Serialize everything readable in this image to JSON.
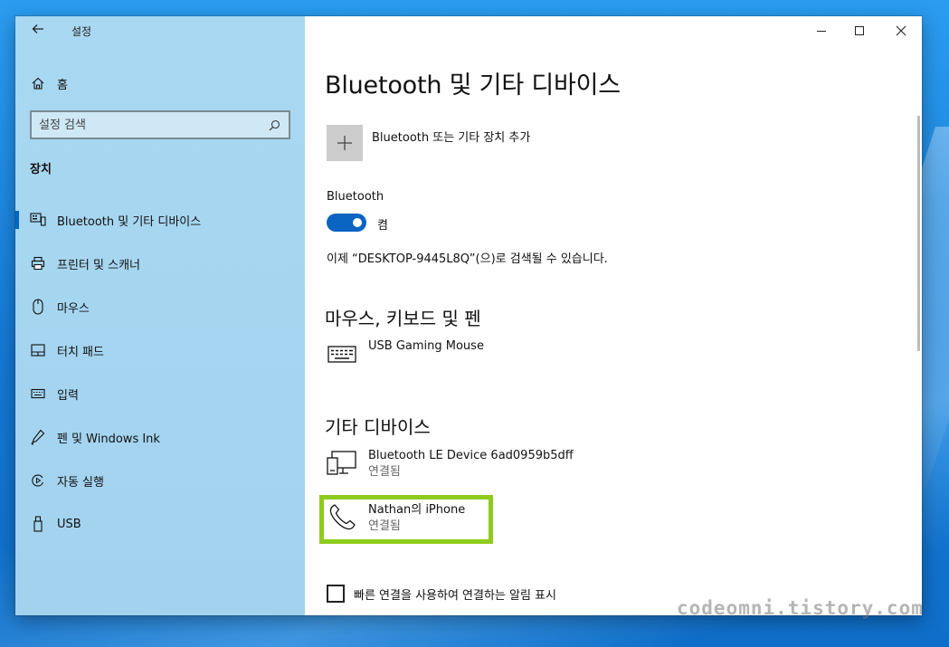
{
  "window": {
    "title": "설정",
    "back_icon": "back-arrow-icon",
    "minimize_icon": "minimize-icon",
    "maximize_icon": "maximize-icon",
    "close_icon": "close-icon"
  },
  "sidebar": {
    "home_label": "홈",
    "search_placeholder": "설정 검색",
    "section_title": "장치",
    "items": [
      {
        "label": "Bluetooth 및 기타 디바이스",
        "icon": "bluetooth-devices-icon",
        "active": true
      },
      {
        "label": "프린터 및 스캐너",
        "icon": "printer-icon",
        "active": false
      },
      {
        "label": "마우스",
        "icon": "mouse-icon",
        "active": false
      },
      {
        "label": "터치 패드",
        "icon": "touchpad-icon",
        "active": false
      },
      {
        "label": "입력",
        "icon": "keyboard-icon",
        "active": false
      },
      {
        "label": "펜 및 Windows Ink",
        "icon": "pen-icon",
        "active": false
      },
      {
        "label": "자동 실행",
        "icon": "autoplay-icon",
        "active": false
      },
      {
        "label": "USB",
        "icon": "usb-icon",
        "active": false
      }
    ]
  },
  "main": {
    "page_title": "Bluetooth 및 기타 디바이스",
    "add_device_label": "Bluetooth 또는 기타 장치 추가",
    "bluetooth_label": "Bluetooth",
    "toggle_state": "켬",
    "discover_text": "이제 “DESKTOP-9445L8Q”(으)로 검색될 수 있습니다.",
    "section_mouse": "마우스, 키보드 및 펜",
    "mouse_devices": [
      {
        "name": "USB Gaming Mouse",
        "status": "",
        "icon": "keyboard-device-icon"
      }
    ],
    "section_other": "기타 디바이스",
    "other_devices": [
      {
        "name": "Bluetooth LE Device 6ad0959b5dff",
        "status": "연결됨",
        "icon": "generic-device-icon"
      },
      {
        "name": "Nathan의 iPhone",
        "status": "연결됨",
        "icon": "phone-icon"
      }
    ],
    "swift_pair_label": "빠른 연결을 사용하여 연결하는 알림 표시"
  },
  "watermark": "codeomni.tistory.com",
  "colors": {
    "accent": "#0a64c2",
    "sidebar_bg": "#a6d6f1",
    "highlight": "#8dcc1c"
  }
}
